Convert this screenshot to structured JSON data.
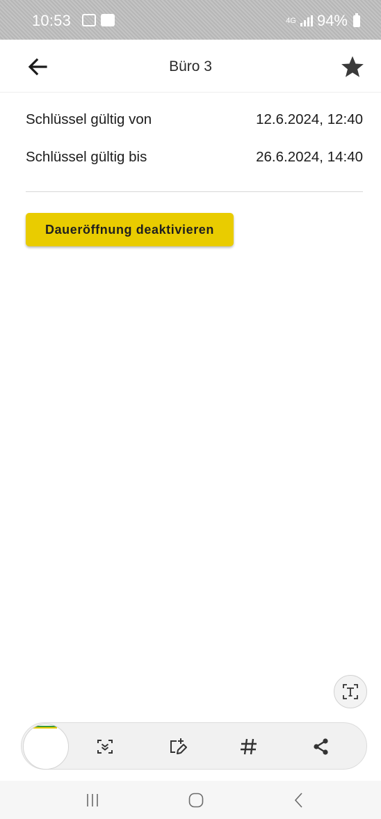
{
  "status_bar": {
    "time": "10:53",
    "network": "4G",
    "battery": "94%",
    "icons": [
      "notification-icon",
      "image-icon",
      "signal-icon",
      "battery-icon"
    ]
  },
  "app_bar": {
    "title": "Büro 3",
    "back_icon": "arrow-left-icon",
    "favorite_icon": "star-icon"
  },
  "key_validity": {
    "from_label": "Schlüssel gültig von",
    "from_value": "12.6.2024, 12:40",
    "until_label": "Schlüssel gültig bis",
    "until_value": "26.6.2024, 14:40"
  },
  "actions": {
    "deactivate_label": "Daueröffnung deaktivieren"
  },
  "capture_toolbar": {
    "tools": [
      "scroll-capture-icon",
      "draw-icon",
      "hashtag-icon",
      "share-icon"
    ],
    "text_extract_icon": "text-extract-icon"
  },
  "nav_bar": {
    "buttons": [
      "recent-apps-icon",
      "home-icon",
      "back-icon"
    ]
  },
  "colors": {
    "accent": "#e9cc00",
    "status_bar": "#bdbdbd",
    "text": "#1f1f1f"
  }
}
